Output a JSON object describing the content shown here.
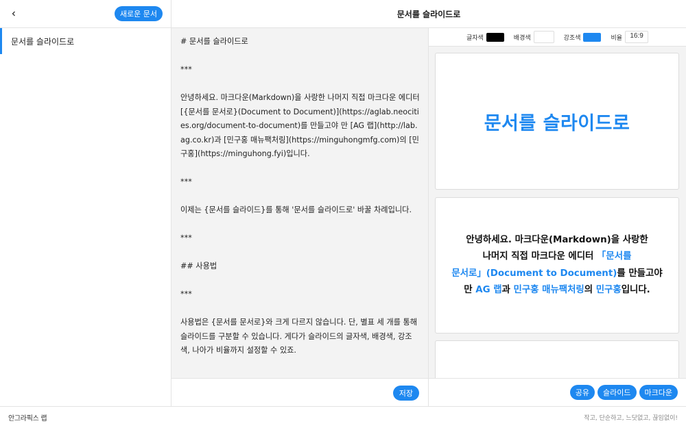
{
  "app": {
    "title": "문서를 슬라이드로"
  },
  "sidebar": {
    "back_icon": "chevron-left-icon",
    "new_button": "새로운 문서",
    "items": [
      {
        "label": "문서를 슬라이드로",
        "active": true
      }
    ]
  },
  "editor": {
    "content": "# 문서를 슬라이드로\n\n***\n\n안녕하세요. 마크다운(Markdown)을 사랑한 나머지 직접 마크다운 에디터 [{문서를 문서로}(Document to Document)](https://aglab.neocities.org/document-to-document)를 만들고야 만 [AG 랩](http://lab.ag.co.kr)과 [민구홍 매뉴팩처링](https://minguhongmfg.com)의 [민구홍](https://minguhong.fyi)입니다.\n\n***\n\n이제는 {문서를 슬라이드}를 통해 '문서를 슬라이드로' 바꿀 차례입니다.\n\n***\n\n## 사용법\n\n***\n\n사용법은 {문서를 문서로}와 크게 다르지 않습니다. 단, 별표 세 개를 통해 슬라이드를 구분할 수 있습니다. 게다가 슬라이드의 글자색, 배경색, 강조색, 나아가 비율까지 설정할 수 있죠.",
    "save_button": "저장"
  },
  "preview": {
    "settings": {
      "text_color_label": "글자색",
      "text_color": "#000000",
      "bg_color_label": "배경색",
      "bg_color": "#ffffff",
      "accent_color_label": "강조색",
      "accent_color": "#1e88f0",
      "ratio_label": "비율",
      "ratio_value": "16:9"
    },
    "slides": {
      "title": "문서를 슬라이드로",
      "body": {
        "t1": "안녕하세요. 마크다운(Markdown)을 사랑한",
        "t2": "나머지 직접 마크다운 에디터 ",
        "h1": "「문서를",
        "h2": "문서로」(Document to Document)",
        "t3": "를 만들고야",
        "t4": "만 ",
        "h3": "AG 랩",
        "t5": "과 ",
        "h4": "민구홍 매뉴팩처링",
        "t6": "의 ",
        "h5": "민구홍",
        "t7": "입니다."
      }
    },
    "buttons": {
      "share": "공유",
      "slides": "슬라이드",
      "markdown": "마크다운"
    }
  },
  "footer": {
    "brand": "안그라픽스 랩",
    "tagline": "작고, 단순하고, 느닷없고, 끊임없이!"
  },
  "colors": {
    "accent": "#1e88f0",
    "editor_bg": "#f3f3f3"
  }
}
